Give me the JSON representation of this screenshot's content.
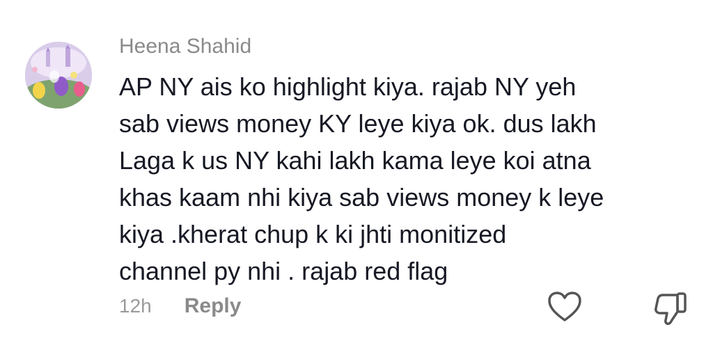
{
  "comment": {
    "author": "Heena Shahid",
    "text_lines": [
      "AP NY ais ko highlight kiya. rajab NY yeh",
      "sab views money KY leye kiya ok. dus lakh",
      "Laga k us NY kahi lakh kama leye koi atna",
      "khas kaam nhi kiya sab views money k leye",
      "kiya .kherat chup k ki jhti monitized",
      "channel py nhi . rajab red flag"
    ],
    "timestamp": "12h",
    "reply_label": "Reply",
    "icons": {
      "avatar": "profile-avatar",
      "like": "heart-outline-icon",
      "dislike": "thumbs-down-outline-icon"
    },
    "colors": {
      "author": "#8a8a8a",
      "text": "#161823",
      "meta": "#9a9a9a",
      "icon": "#555555"
    }
  }
}
